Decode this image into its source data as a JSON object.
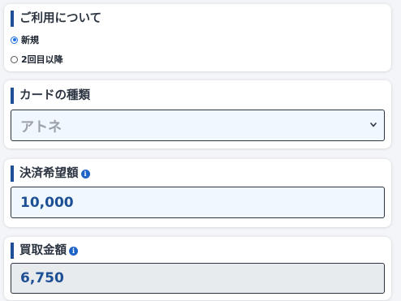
{
  "usage": {
    "title": "ご利用について",
    "options": [
      {
        "label": "新規",
        "checked": true
      },
      {
        "label": "2回目以降",
        "checked": false
      }
    ]
  },
  "card_type": {
    "title": "カードの種類",
    "selected": "アトネ",
    "icon": "chevron-down-icon"
  },
  "desired_amount": {
    "title": "決済希望額",
    "info_icon": "i",
    "value": "10,000"
  },
  "purchase_amount": {
    "title": "買取金額",
    "info_icon": "i",
    "value": "6,750"
  },
  "colors": {
    "accent": "#1f4f96",
    "value_text": "#1d4f95",
    "input_bg": "#f1f8fd",
    "readonly_bg": "#e8ebee",
    "info_icon_bg": "#1f63c6"
  }
}
